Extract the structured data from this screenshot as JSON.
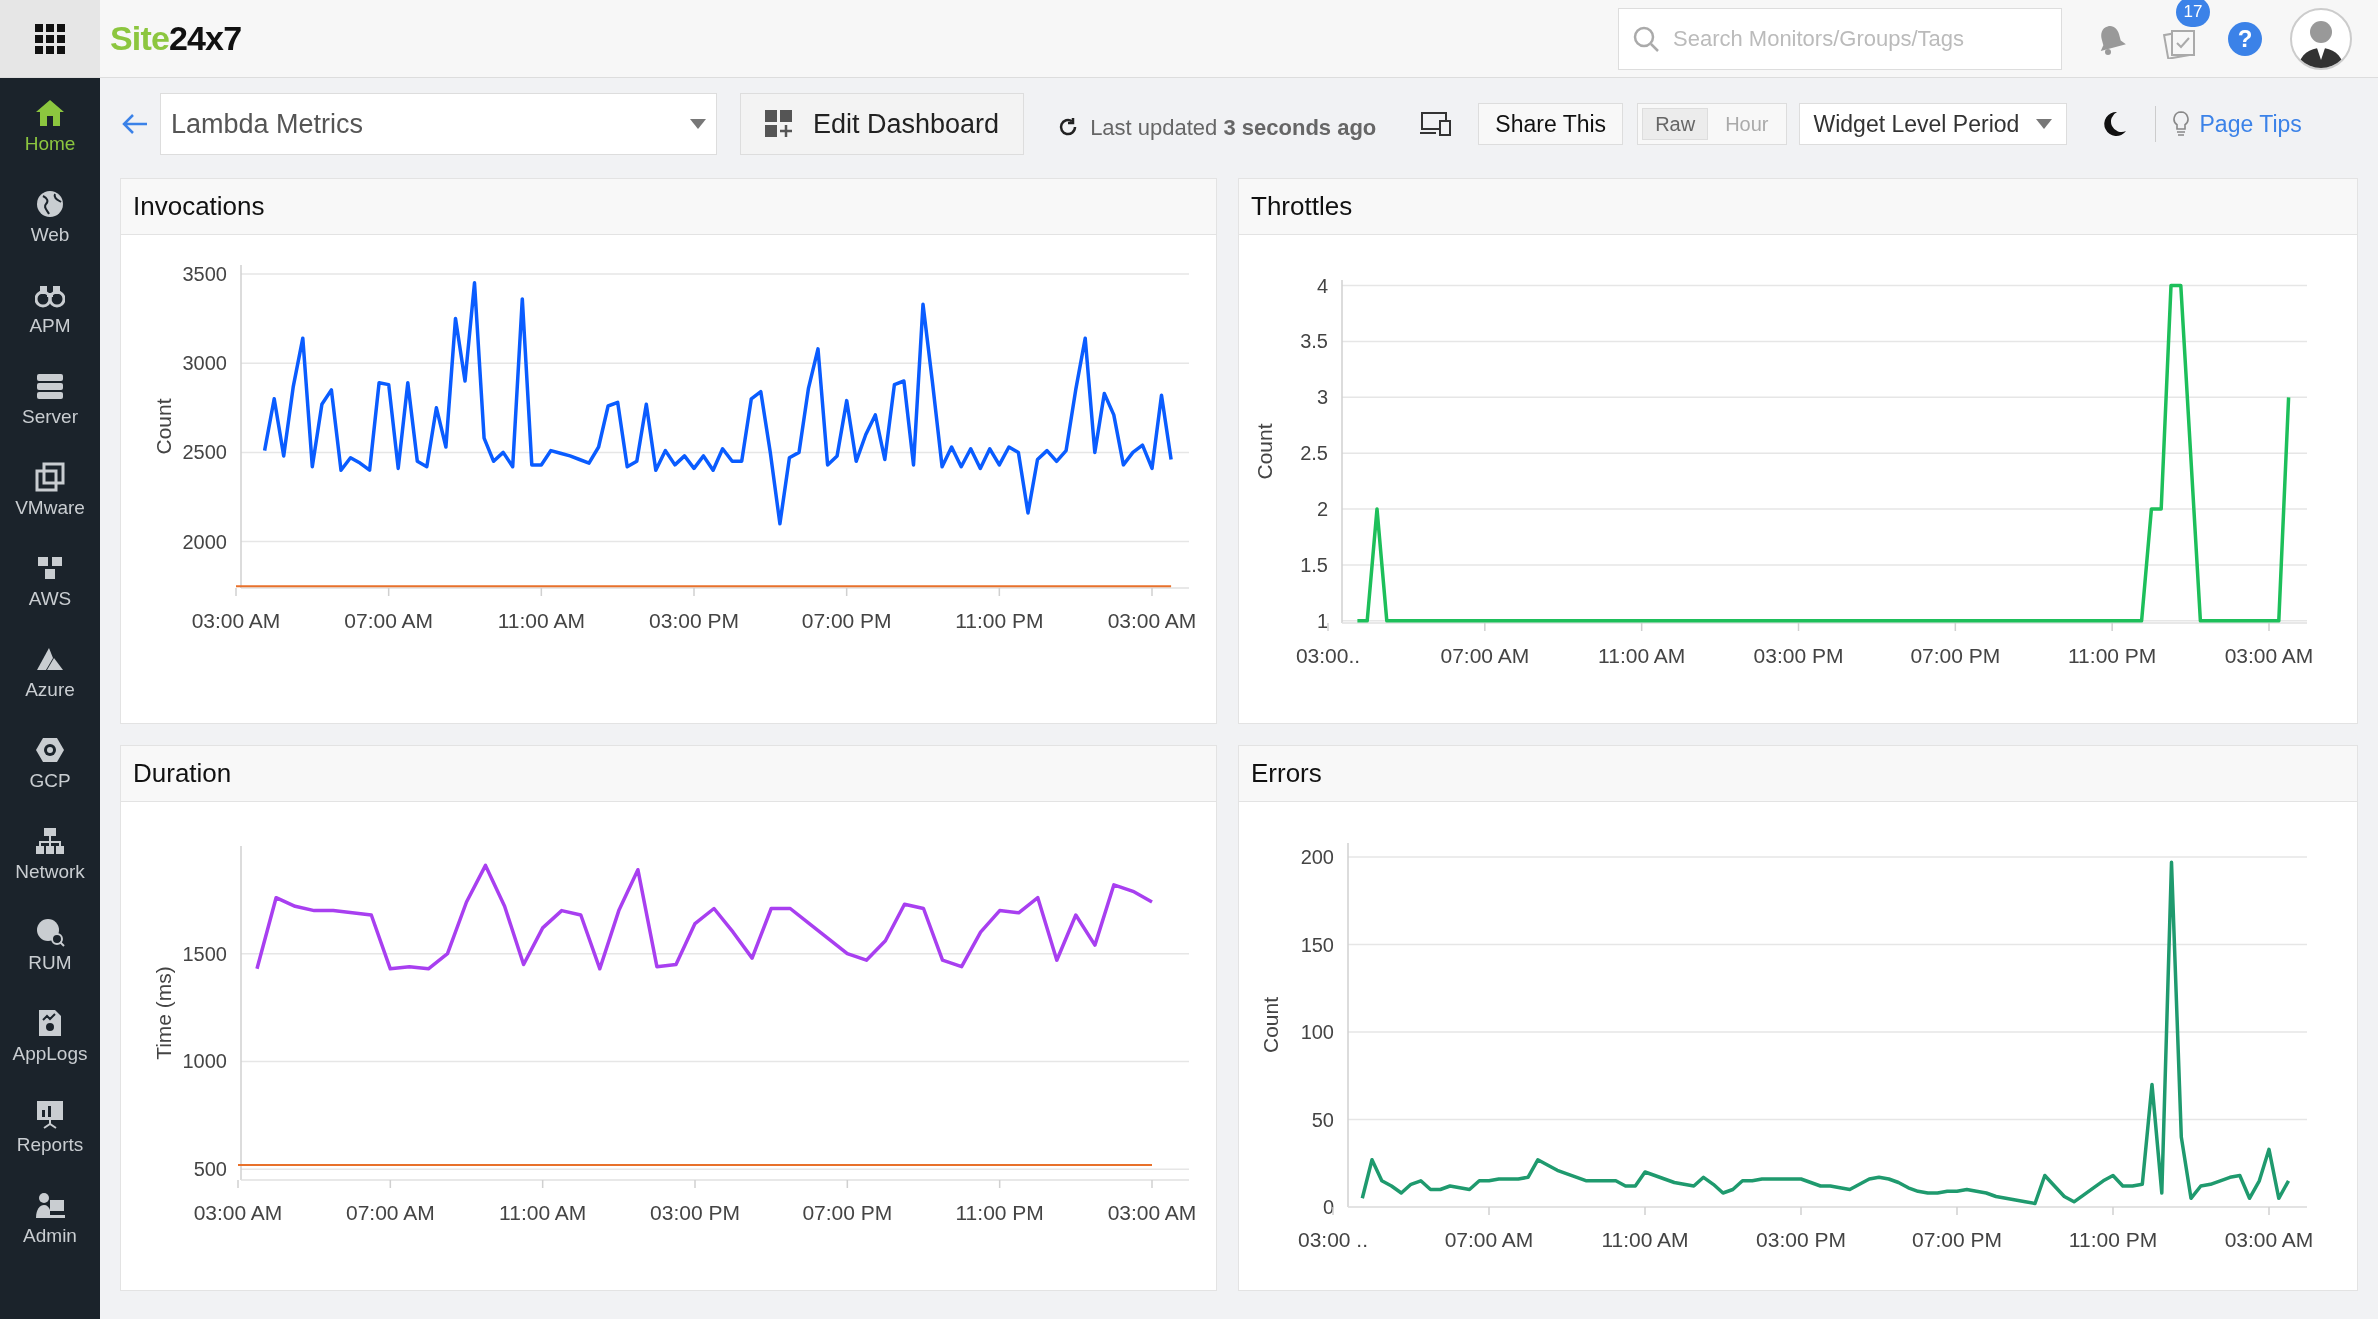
{
  "header": {
    "logo": {
      "accent": "Site",
      "rest": "24x7"
    },
    "search": {
      "placeholder": "Search Monitors/Groups/Tags"
    },
    "tasks_badge": "17",
    "help_icon": "?"
  },
  "sidebar": {
    "items": [
      {
        "label": "Home",
        "selected": true
      },
      {
        "label": "Web",
        "selected": false
      },
      {
        "label": "APM",
        "selected": false
      },
      {
        "label": "Server",
        "selected": false
      },
      {
        "label": "VMware",
        "selected": false
      },
      {
        "label": "AWS",
        "selected": false
      },
      {
        "label": "Azure",
        "selected": false
      },
      {
        "label": "GCP",
        "selected": false
      },
      {
        "label": "Network",
        "selected": false
      },
      {
        "label": "RUM",
        "selected": false
      },
      {
        "label": "AppLogs",
        "selected": false
      },
      {
        "label": "Reports",
        "selected": false
      },
      {
        "label": "Admin",
        "selected": false
      }
    ]
  },
  "toolbar": {
    "dashboard": "Lambda Metrics",
    "edit_button": "Edit Dashboard",
    "last_updated": "Last updated **3 seconds ago**",
    "share_button": "Share This",
    "granularity": [
      {
        "label": "Raw",
        "selected": true
      },
      {
        "label": "Hour",
        "selected": false
      }
    ],
    "period": "Widget Level Period",
    "page_tips": "Page Tips"
  },
  "widgets": [
    {
      "title": "Invocations",
      "chart_data": {
        "type": "line",
        "grid": true,
        "ylabel": "Count",
        "ylim": [
          1740,
          3550
        ],
        "yticks": [
          2000,
          2500,
          3000,
          3500
        ],
        "categories": [
          "03:00 AM",
          null,
          null,
          null,
          null,
          null,
          null,
          null,
          null,
          null,
          null,
          null,
          null,
          null,
          null,
          null,
          "07:00 AM",
          null,
          null,
          null,
          null,
          null,
          null,
          null,
          null,
          null,
          null,
          null,
          null,
          null,
          null,
          null,
          "11:00 AM",
          null,
          null,
          null,
          null,
          null,
          null,
          null,
          null,
          null,
          null,
          null,
          null,
          null,
          null,
          null,
          "03:00 PM",
          null,
          null,
          null,
          null,
          null,
          null,
          null,
          null,
          null,
          null,
          null,
          null,
          null,
          null,
          null,
          "07:00 PM",
          null,
          null,
          null,
          null,
          null,
          null,
          null,
          null,
          null,
          null,
          null,
          null,
          null,
          null,
          null,
          "11:00 PM",
          null,
          null,
          null,
          null,
          null,
          null,
          null,
          null,
          null,
          null,
          null,
          null,
          null,
          null,
          null,
          "03:00 AM",
          null,
          null
        ],
        "series": [
          {
            "color": "#0a5cff",
            "values": [
              null,
              null,
              null,
              2510,
              2800,
              2480,
              2870,
              3140,
              2420,
              2770,
              2850,
              2400,
              2470,
              2440,
              2400,
              2890,
              2880,
              2410,
              2890,
              2450,
              2420,
              2750,
              2530,
              3250,
              2900,
              3450,
              2580,
              2450,
              2500,
              2420,
              3360,
              2430,
              2430,
              2510,
              2495,
              2480,
              2460,
              2440,
              2530,
              2760,
              2780,
              2420,
              2450,
              2770,
              2400,
              2510,
              2430,
              2480,
              2410,
              2480,
              2400,
              2520,
              2450,
              2450,
              2800,
              2840,
              2500,
              2100,
              2470,
              2500,
              2860,
              3080,
              2430,
              2480,
              2790,
              2450,
              2600,
              2710,
              2460,
              2880,
              2900,
              2430,
              3330,
              2890,
              2420,
              2530,
              2420,
              2520,
              2410,
              2520,
              2430,
              2530,
              2500,
              2160,
              2460,
              2510,
              2450,
              2510,
              2850,
              3140,
              2500,
              2830,
              2710,
              2430,
              2500,
              2540,
              2410,
              2820,
              2460
            ]
          },
          {
            "color": "#e8712b",
            "values": [
              1750,
              1750,
              1750,
              1750,
              1750,
              1750,
              1750,
              1750,
              1750,
              1750,
              1750,
              1750,
              1750,
              1750,
              1750,
              1750,
              1750,
              1750,
              1750,
              1750,
              1750,
              1750,
              1750,
              1750,
              1750,
              1750,
              1750,
              1750,
              1750,
              1750,
              1750,
              1750,
              1750,
              1750,
              1750,
              1750,
              1750,
              1750,
              1750,
              1750,
              1750,
              1750,
              1750,
              1750,
              1750,
              1750,
              1750,
              1750,
              1750,
              1750,
              1750,
              1750,
              1750,
              1750,
              1750,
              1750,
              1750,
              1750,
              1750,
              1750,
              1750,
              1750,
              1750,
              1750,
              1750,
              1750,
              1750,
              1750,
              1750,
              1750,
              1750,
              1750,
              1750,
              1750,
              1750,
              1750,
              1750,
              1750,
              1750,
              1750,
              1750,
              1750,
              1750,
              1750,
              1750,
              1750,
              1750,
              1750,
              1750,
              1750,
              1750,
              1750,
              1750,
              1750,
              1750,
              1750,
              1750,
              1750,
              1750
            ]
          }
        ]
      }
    },
    {
      "title": "Throttles",
      "chart_data": {
        "type": "line",
        "grid": true,
        "ylabel": "Count",
        "ylim": [
          0.98,
          4.05
        ],
        "yticks": [
          1,
          1.5,
          2,
          2.5,
          3,
          3.5,
          4
        ],
        "categories": [
          "03:00..",
          null,
          null,
          null,
          null,
          null,
          null,
          null,
          null,
          null,
          null,
          null,
          null,
          null,
          null,
          null,
          "07:00 AM",
          null,
          null,
          null,
          null,
          null,
          null,
          null,
          null,
          null,
          null,
          null,
          null,
          null,
          null,
          null,
          "11:00 AM",
          null,
          null,
          null,
          null,
          null,
          null,
          null,
          null,
          null,
          null,
          null,
          null,
          null,
          null,
          null,
          "03:00 PM",
          null,
          null,
          null,
          null,
          null,
          null,
          null,
          null,
          null,
          null,
          null,
          null,
          null,
          null,
          null,
          "07:00 PM",
          null,
          null,
          null,
          null,
          null,
          null,
          null,
          null,
          null,
          null,
          null,
          null,
          null,
          null,
          null,
          "11:00 PM",
          null,
          null,
          null,
          null,
          null,
          null,
          null,
          null,
          null,
          null,
          null,
          null,
          null,
          null,
          null,
          "03:00 AM",
          null,
          null
        ],
        "series": [
          {
            "color": "#1dbf5a",
            "values": [
              null,
              null,
              null,
              1,
              1,
              2,
              1,
              1,
              1,
              1,
              1,
              1,
              1,
              1,
              1,
              1,
              1,
              1,
              1,
              1,
              1,
              1,
              1,
              1,
              1,
              1,
              1,
              1,
              1,
              1,
              1,
              1,
              1,
              1,
              1,
              1,
              1,
              1,
              1,
              1,
              1,
              1,
              1,
              1,
              1,
              1,
              1,
              1,
              1,
              1,
              1,
              1,
              1,
              1,
              1,
              1,
              1,
              1,
              1,
              1,
              1,
              1,
              1,
              1,
              1,
              1,
              1,
              1,
              1,
              1,
              1,
              1,
              1,
              1,
              1,
              1,
              1,
              1,
              1,
              1,
              1,
              1,
              1,
              1,
              2,
              2,
              4,
              4,
              2.5,
              1,
              1,
              1,
              1,
              1,
              1,
              1,
              1,
              1,
              3
            ]
          }
        ]
      }
    },
    {
      "title": "Duration",
      "chart_data": {
        "type": "line",
        "grid": true,
        "ylabel": "Time (ms)",
        "ylim": [
          450,
          2000
        ],
        "yticks": [
          500,
          1000,
          1500
        ],
        "categories": [
          "03:00 AM",
          null,
          null,
          null,
          null,
          null,
          null,
          null,
          "07:00 AM",
          null,
          null,
          null,
          null,
          null,
          null,
          null,
          "11:00 AM",
          null,
          null,
          null,
          null,
          null,
          null,
          null,
          "03:00 PM",
          null,
          null,
          null,
          null,
          null,
          null,
          null,
          "07:00 PM",
          null,
          null,
          null,
          null,
          null,
          null,
          null,
          "11:00 PM",
          null,
          null,
          null,
          null,
          null,
          null,
          null,
          "03:00 AM"
        ],
        "series": [
          {
            "color": "#a83ff0",
            "values": [
              null,
              1430,
              1760,
              1720,
              1700,
              1700,
              1690,
              1680,
              1430,
              1440,
              1430,
              1500,
              1740,
              1910,
              1720,
              1450,
              1620,
              1700,
              1680,
              1430,
              1700,
              1890,
              1440,
              1450,
              1640,
              1710,
              1600,
              1480,
              1710,
              1710,
              1640,
              1570,
              1500,
              1470,
              1560,
              1730,
              1710,
              1470,
              1440,
              1600,
              1700,
              1690,
              1760,
              1470,
              1680,
              1540,
              1820,
              1790,
              1740
            ]
          },
          {
            "color": "#e8712b",
            "values": [
              520,
              520,
              520,
              520,
              520,
              520,
              520,
              520,
              520,
              520,
              520,
              520,
              520,
              520,
              520,
              520,
              520,
              520,
              520,
              520,
              520,
              520,
              520,
              520,
              520,
              520,
              520,
              520,
              520,
              520,
              520,
              520,
              520,
              520,
              520,
              520,
              520,
              520,
              520,
              520,
              520,
              520,
              520,
              520,
              520,
              520,
              520,
              520,
              520
            ]
          }
        ]
      }
    },
    {
      "title": "Errors",
      "chart_data": {
        "type": "line",
        "grid": true,
        "ylabel": "Count",
        "ylim": [
          0,
          208
        ],
        "yticks": [
          0,
          50,
          100,
          150,
          200
        ],
        "categories": [
          "03:00 ..",
          null,
          null,
          null,
          null,
          null,
          null,
          null,
          null,
          null,
          null,
          null,
          null,
          null,
          null,
          null,
          "07:00 AM",
          null,
          null,
          null,
          null,
          null,
          null,
          null,
          null,
          null,
          null,
          null,
          null,
          null,
          null,
          null,
          "11:00 AM",
          null,
          null,
          null,
          null,
          null,
          null,
          null,
          null,
          null,
          null,
          null,
          null,
          null,
          null,
          null,
          "03:00 PM",
          null,
          null,
          null,
          null,
          null,
          null,
          null,
          null,
          null,
          null,
          null,
          null,
          null,
          null,
          null,
          "07:00 PM",
          null,
          null,
          null,
          null,
          null,
          null,
          null,
          null,
          null,
          null,
          null,
          null,
          null,
          null,
          null,
          "11:00 PM",
          null,
          null,
          null,
          null,
          null,
          null,
          null,
          null,
          null,
          null,
          null,
          null,
          null,
          null,
          null,
          "03:00 AM",
          null,
          null
        ],
        "series": [
          {
            "color": "#1f9a6e",
            "values": [
              null,
              null,
              null,
              5,
              27,
              15,
              12,
              8,
              13,
              15,
              10,
              10,
              12,
              11,
              10,
              15,
              15,
              16,
              16,
              16,
              17,
              27,
              24,
              21,
              19,
              17,
              15,
              15,
              15,
              15,
              12,
              12,
              20,
              18,
              16,
              14,
              13,
              12,
              17,
              13,
              8,
              10,
              15,
              15,
              16,
              16,
              16,
              16,
              16,
              14,
              12,
              12,
              11,
              10,
              13,
              16,
              17,
              16,
              14,
              11,
              9,
              8,
              8,
              9,
              9,
              10,
              9,
              8,
              6,
              5,
              4,
              3,
              2,
              18,
              12,
              6,
              3,
              7,
              11,
              15,
              18,
              12,
              12,
              13,
              70,
              8,
              197,
              40,
              5,
              12,
              13,
              15,
              17,
              18,
              5,
              15,
              33,
              5,
              15
            ]
          }
        ]
      }
    }
  ]
}
